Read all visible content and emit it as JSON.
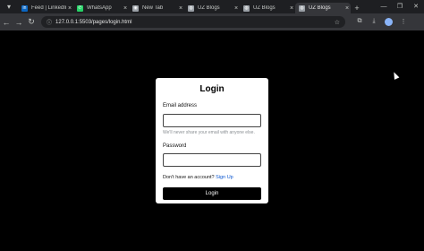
{
  "browser": {
    "tabs": [
      {
        "label": "Feed | LinkedIn",
        "favicon": "linkedin-icon",
        "color": "#0a66c2",
        "glyph": "in"
      },
      {
        "label": "WhatsApp",
        "favicon": "whatsapp-icon",
        "color": "#25d366",
        "glyph": "✆"
      },
      {
        "label": "New Tab",
        "favicon": "chrome-icon",
        "color": "#9aa0a6",
        "glyph": "◉"
      },
      {
        "label": "UZ Blogs",
        "favicon": "globe-icon",
        "color": "#9aa0a6",
        "glyph": "◍"
      },
      {
        "label": "UZ Blogs",
        "favicon": "globe-icon",
        "color": "#9aa0a6",
        "glyph": "◍"
      },
      {
        "label": "UZ Blogs",
        "favicon": "globe-icon",
        "color": "#9aa0a6",
        "glyph": "◍"
      }
    ],
    "active_tab_index": 5,
    "url": "127.0.0.1:5503/pages/login.html"
  },
  "login": {
    "title": "Login",
    "email_label": "Email address",
    "email_value": "",
    "email_help": "We'll never share your email with anyone else.",
    "password_label": "Password",
    "password_value": "",
    "signup_prompt": "Don't have an account?",
    "signup_link": "Sign Up",
    "submit_label": "Login"
  }
}
